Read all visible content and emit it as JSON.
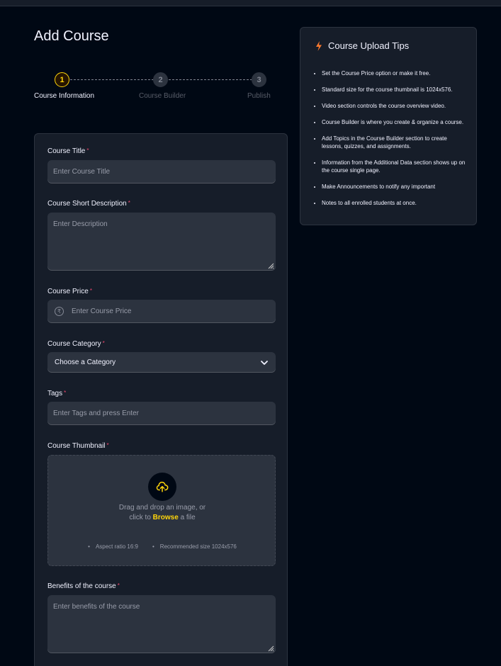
{
  "page": {
    "title": "Add Course"
  },
  "stepper": {
    "steps": [
      {
        "number": "1",
        "label": "Course Information"
      },
      {
        "number": "2",
        "label": "Course Builder"
      },
      {
        "number": "3",
        "label": "Publish"
      }
    ],
    "active_step": 1
  },
  "form": {
    "title": {
      "label": "Course Title",
      "placeholder": "Enter Course Title"
    },
    "short_description": {
      "label": "Course Short Description",
      "placeholder": "Enter Description"
    },
    "price": {
      "label": "Course Price",
      "placeholder": "Enter Course Price",
      "currency_symbol": "₹"
    },
    "category": {
      "label": "Course Category",
      "selected": "Choose a Category"
    },
    "tags": {
      "label": "Tags",
      "placeholder": "Enter Tags and press Enter"
    },
    "thumbnail": {
      "label": "Course Thumbnail",
      "drop_text_line1": "Drag and drop an image, or",
      "drop_text_click": "click to",
      "browse_label": "Browse",
      "drop_text_end": "a file",
      "hint_aspect": "Aspect ratio 16:9",
      "hint_size": "Recommended size 1024x576"
    },
    "benefits": {
      "label": "Benefits of the course",
      "placeholder": "Enter benefits of the course"
    },
    "required_mark": "*"
  },
  "tips": {
    "title": "Course Upload Tips",
    "items": [
      "Set the Course Price option or make it free.",
      "Standard size for the course thumbnail is 1024x576.",
      "Video section controls the course overview video.",
      "Course Builder is where you create & organize a course.",
      "Add Topics in the Course Builder section to create lessons, quizzes, and assignments.",
      "Information from the Additional Data section shows up on the course single page.",
      "Make Announcements to notify any important",
      "Notes to all enrolled students at once."
    ]
  },
  "colors": {
    "background": "#000814",
    "card": "#161d29",
    "input": "#2c333f",
    "accent": "#ffd60a",
    "required": "#ef476f",
    "bolt": "#ff7a2e"
  }
}
